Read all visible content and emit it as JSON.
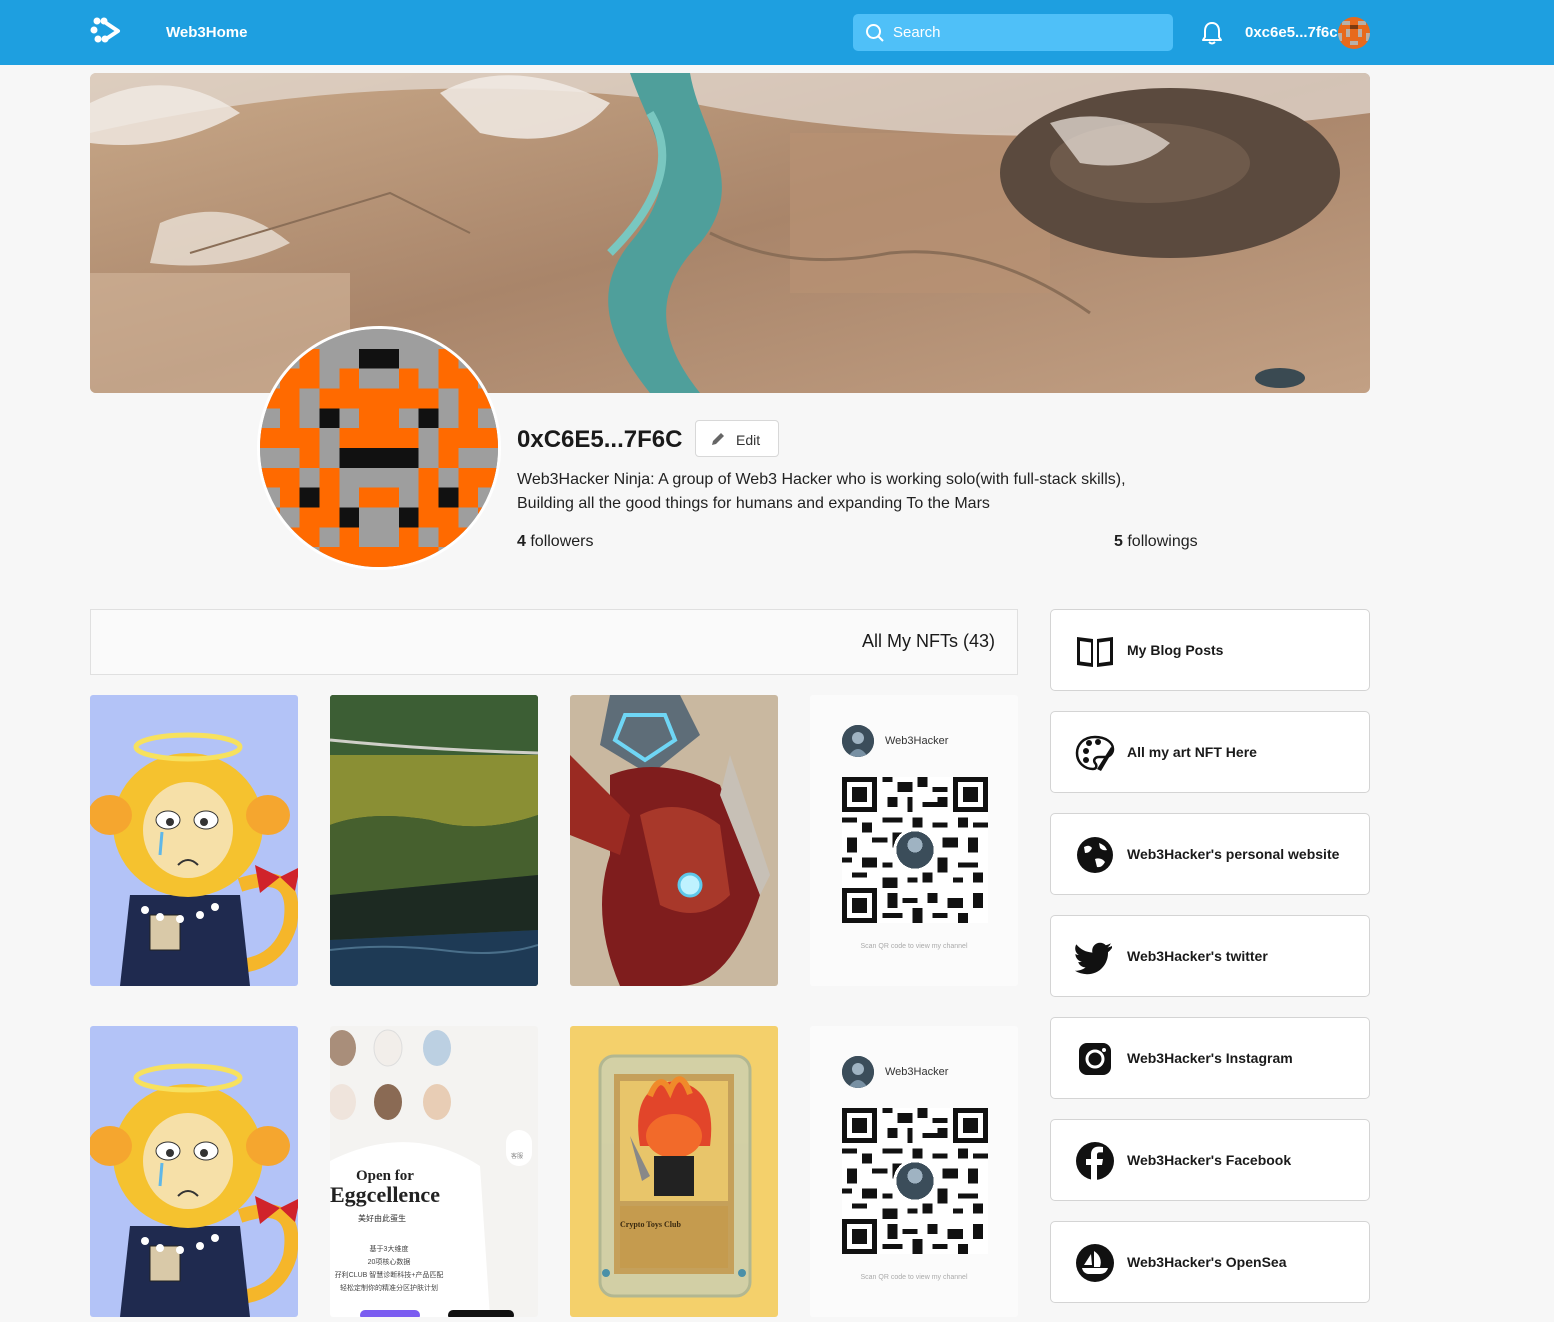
{
  "topbar": {
    "brand": "Web3Home",
    "search_placeholder": "Search",
    "wallet": "0xc6e5...7f6c"
  },
  "profile": {
    "name": "0xC6E5...7F6C",
    "edit_label": "Edit",
    "bio_line1": "Web3Hacker Ninja: A group of Web3 Hacker who is working solo(with full-stack skills),",
    "bio_line2": "Building all the good things for humans and expanding To the Mars",
    "followers_count": "4",
    "followers_label": " followers",
    "followings_count": "5",
    "followings_label": " followings"
  },
  "nfts": {
    "title": "All My NFTs (43)",
    "qr_user": "Web3Hacker",
    "qr_note": "Scan QR code to view my channel",
    "egg_title1": "Open for",
    "egg_title2": "Eggcellence",
    "egg_sub": "美好由此蛋生",
    "egg_l1": "基于3大维度",
    "egg_l2": "20项核心数据",
    "egg_l3": "孖利CLUB 智慧诊断科技+产品匹配",
    "egg_l4": "轻松定制你的精准分区护肤计划",
    "egg_side": "客服",
    "card_title": "Crypto Toys Club"
  },
  "links": [
    {
      "label": "My Blog Posts",
      "icon": "book-icon"
    },
    {
      "label": "All my art NFT Here",
      "icon": "palette-icon"
    },
    {
      "label": "Web3Hacker's personal website",
      "icon": "globe-icon"
    },
    {
      "label": "Web3Hacker's twitter",
      "icon": "twitter-icon"
    },
    {
      "label": "Web3Hacker's Instagram",
      "icon": "instagram-icon"
    },
    {
      "label": "Web3Hacker's Facebook",
      "icon": "facebook-icon"
    },
    {
      "label": "Web3Hacker's OpenSea",
      "icon": "opensea-icon"
    }
  ],
  "colors": {
    "topbar": "#1e9fe0",
    "search": "#4fc0f8",
    "identicon_orange": "#ff6a00",
    "identicon_gray": "#9e9e9e"
  }
}
